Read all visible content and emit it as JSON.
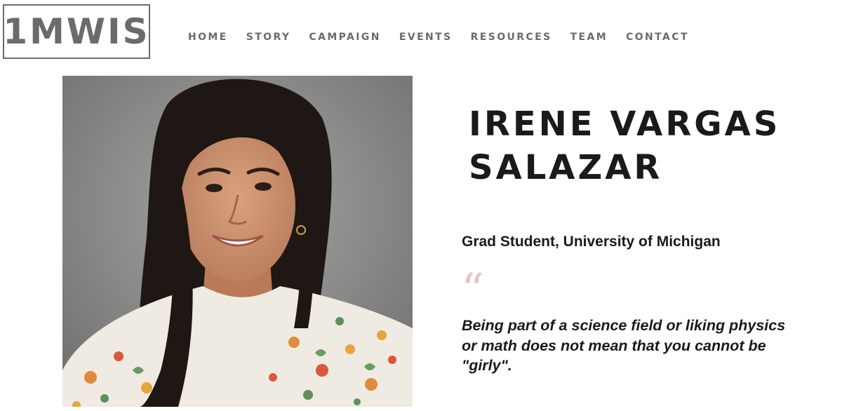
{
  "logo": {
    "text": "1MWIS"
  },
  "nav": {
    "items": [
      {
        "label": "HOME"
      },
      {
        "label": "STORY"
      },
      {
        "label": "CAMPAIGN"
      },
      {
        "label": "EVENTS"
      },
      {
        "label": "RESOURCES"
      },
      {
        "label": "TEAM"
      },
      {
        "label": "CONTACT"
      }
    ]
  },
  "profile": {
    "name_lines": [
      "IRENE VARGAS",
      "SALAZAR"
    ],
    "role": "Grad Student, University of Michigan",
    "quote_mark": "“",
    "quote_lines": [
      "Being part of a science field or liking physics",
      "or math does not mean that you cannot be",
      "\"girly\"."
    ]
  },
  "colors": {
    "nav_text": "#6b6b6b",
    "heading": "#1a1a1a",
    "quote_mark": "#e6c4c6",
    "photo_background": "#8c8c8a"
  }
}
